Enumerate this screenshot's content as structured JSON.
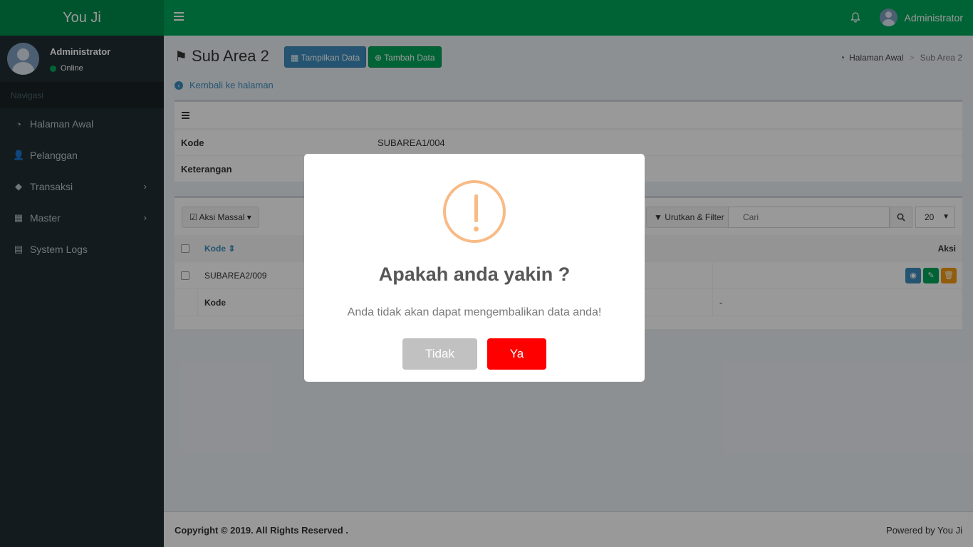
{
  "app": {
    "logo": "You Ji"
  },
  "header": {
    "user": "Administrator"
  },
  "sidebar": {
    "user_name": "Administrator",
    "status": "Online",
    "nav_header": "Navigasi",
    "items": [
      {
        "label": "Halaman Awal",
        "icon": "dashboard-icon"
      },
      {
        "label": "Pelanggan",
        "icon": "user-plus-icon"
      },
      {
        "label": "Transaksi",
        "icon": "tags-icon"
      },
      {
        "label": "Master",
        "icon": "grid-icon"
      },
      {
        "label": "System Logs",
        "icon": "file-icon"
      }
    ]
  },
  "page": {
    "title": "Sub Area 2",
    "btn_show": "Tampilkan Data",
    "btn_add": "Tambah Data",
    "breadcrumb_home": "Halaman Awal",
    "breadcrumb_current": "Sub Area 2",
    "back_link": "Kembali ke halaman"
  },
  "detail": {
    "kode_label": "Kode",
    "kode_value": "SUBAREA1/004",
    "keterangan_label": "Keterangan",
    "keterangan_value": ""
  },
  "list": {
    "bulk_action": "Aksi Massal",
    "sort_filter": "Urutkan & Filter",
    "search_placeholder": "Cari",
    "page_size": "20",
    "col_kode": "Kode",
    "col_aksi": "Aksi",
    "rows": [
      {
        "kode": "SUBAREA2/009"
      }
    ],
    "footer_kode": "Kode",
    "footer_dash": "-"
  },
  "footer": {
    "copyright": "Copyright © 2019. All Rights Reserved .",
    "powered": "Powered by You Ji"
  },
  "modal": {
    "title": "Apakah anda yakin ?",
    "text": "Anda tidak akan dapat mengembalikan data anda!",
    "cancel": "Tidak",
    "confirm": "Ya",
    "icon": "warning-icon"
  },
  "colors": {
    "header": "#00a65a",
    "sidebar": "#222d32",
    "confirm": "#ff0000",
    "cancel": "#c1c1c1",
    "warning": "#f8bb86"
  }
}
